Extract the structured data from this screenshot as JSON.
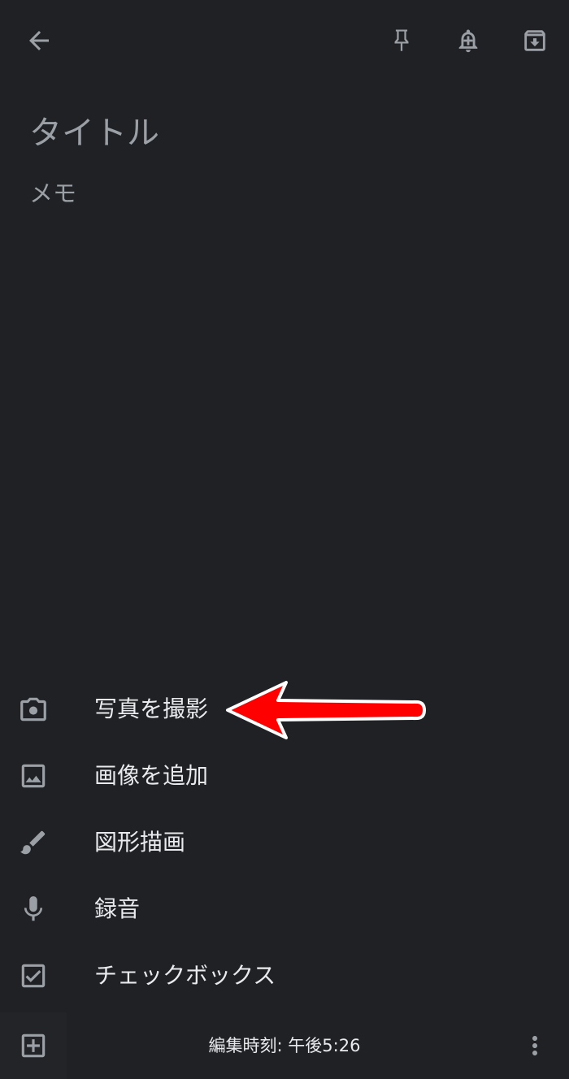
{
  "note": {
    "title_placeholder": "タイトル",
    "body_placeholder": "メモ"
  },
  "toolbar": {
    "back_icon": "arrow-back-icon",
    "pin_icon": "pin-icon",
    "reminder_icon": "reminder-bell-icon",
    "archive_icon": "archive-icon"
  },
  "menu": {
    "items": [
      {
        "label": "写真を撮影",
        "icon": "camera-icon"
      },
      {
        "label": "画像を追加",
        "icon": "image-icon"
      },
      {
        "label": "図形描画",
        "icon": "brush-icon"
      },
      {
        "label": "録音",
        "icon": "mic-icon"
      },
      {
        "label": "チェックボックス",
        "icon": "checkbox-icon"
      }
    ]
  },
  "bottom": {
    "edited_time": "編集時刻: 午後5:26",
    "add_icon": "add-box-icon",
    "more_icon": "more-vertical-icon"
  },
  "colors": {
    "background": "#202124",
    "icon": "#9aa0a6",
    "text": "#e8eaed",
    "placeholder": "#9aa0a6",
    "annotation_arrow": "#ff0000"
  }
}
